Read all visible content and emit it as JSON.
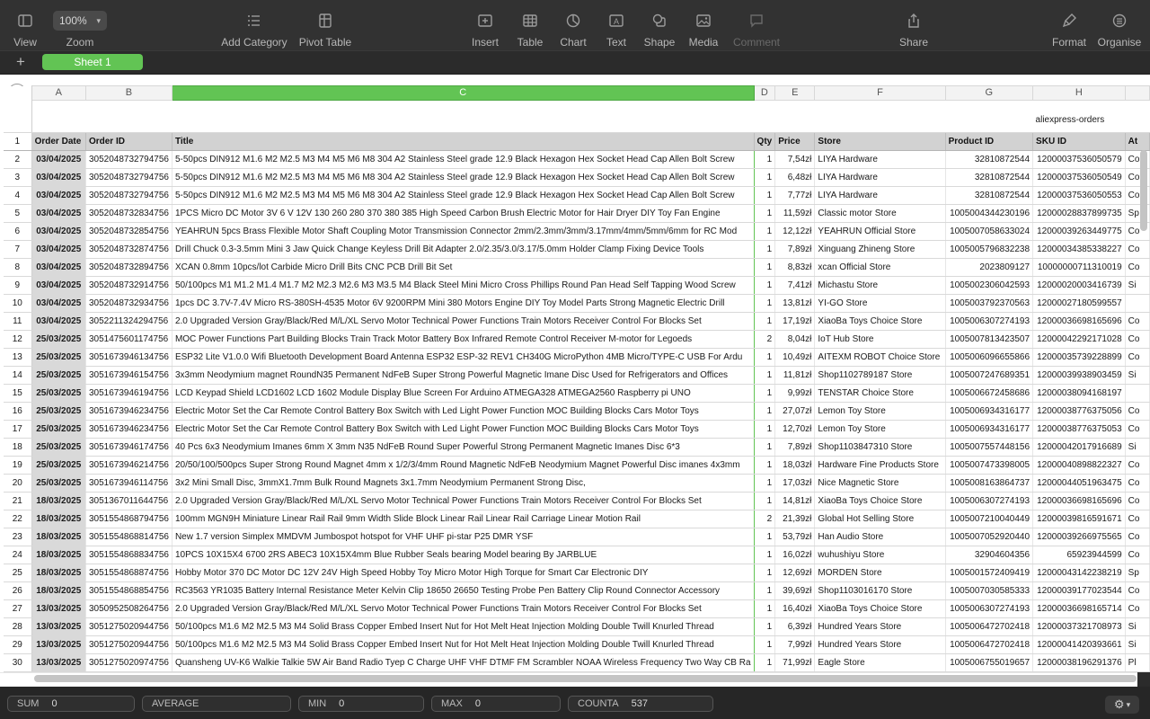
{
  "toolbar": {
    "view": "View",
    "zoom_value": "100%",
    "zoom": "Zoom",
    "add_category": "Add Category",
    "pivot_table": "Pivot Table",
    "insert": "Insert",
    "table": "Table",
    "chart": "Chart",
    "text": "Text",
    "shape": "Shape",
    "media": "Media",
    "comment": "Comment",
    "share": "Share",
    "format": "Format",
    "organise": "Organise"
  },
  "sheets": {
    "active": "Sheet 1",
    "add": "+"
  },
  "columns": [
    "A",
    "B",
    "C",
    "D",
    "E",
    "F",
    "G",
    "H"
  ],
  "selected_column": "C",
  "sheet_title": "aliexpress-orders",
  "headers": [
    "Order Date",
    "Order ID",
    "Title",
    "Qty",
    "Price",
    "Store",
    "Product ID",
    "SKU ID",
    "At"
  ],
  "rows": [
    {
      "n": "2",
      "date": "03/04/2025",
      "id": "3052048732794756",
      "title": "5-50pcs DIN912 M1.6 M2 M2.5 M3 M4 M5 M6 M8 304  A2 Stainless Steel grade 12.9 Black Hexagon Hex Socket Head Cap Allen Bolt Screw",
      "qty": "1",
      "price": "7,54zł",
      "store": "LIYA Hardware",
      "pid": "32810872544",
      "sku": "12000037536050579",
      "a": "Co"
    },
    {
      "n": "3",
      "date": "03/04/2025",
      "id": "3052048732794756",
      "title": "5-50pcs DIN912 M1.6 M2 M2.5 M3 M4 M5 M6 M8 304  A2 Stainless Steel grade 12.9 Black Hexagon Hex Socket Head Cap Allen Bolt Screw",
      "qty": "1",
      "price": "6,48zł",
      "store": "LIYA Hardware",
      "pid": "32810872544",
      "sku": "12000037536050549",
      "a": "Co"
    },
    {
      "n": "4",
      "date": "03/04/2025",
      "id": "3052048732794756",
      "title": "5-50pcs DIN912 M1.6 M2 M2.5 M3 M4 M5 M6 M8 304  A2 Stainless Steel grade 12.9 Black Hexagon Hex Socket Head Cap Allen Bolt Screw",
      "qty": "1",
      "price": "7,77zł",
      "store": "LIYA Hardware",
      "pid": "32810872544",
      "sku": "12000037536050553",
      "a": "Co"
    },
    {
      "n": "5",
      "date": "03/04/2025",
      "id": "3052048732834756",
      "title": "1PCS Micro DC Motor 3V 6 V 12V 130 260 280 370 380 385 High Speed Carbon Brush Electric Motor for Hair Dryer DIY Toy Fan Engine",
      "qty": "1",
      "price": "11,59zł",
      "store": "Classic motor Store",
      "pid": "1005004344230196",
      "sku": "12000028837899735",
      "a": "Sp"
    },
    {
      "n": "6",
      "date": "03/04/2025",
      "id": "3052048732854756",
      "title": "YEAHRUN 5pcs Brass Flexible Motor Shaft Coupling Motor Transmission Connector 2mm/2.3mm/3mm/3.17mm/4mm/5mm/6mm for RC Mod",
      "qty": "1",
      "price": "12,12zł",
      "store": "YEAHRUN Official Store",
      "pid": "1005007058633024",
      "sku": "12000039263449775",
      "a": "Co"
    },
    {
      "n": "7",
      "date": "03/04/2025",
      "id": "3052048732874756",
      "title": "Drill Chuck 0.3-3.5mm Mini 3 Jaw Quick Change Keyless Drill Bit Adapter 2.0/2.35/3.0/3.17/5.0mm Holder Clamp Fixing Device Tools",
      "qty": "1",
      "price": "7,89zł",
      "store": "Xinguang Zhineng Store",
      "pid": "1005005796832238",
      "sku": "12000034385338227",
      "a": "Co"
    },
    {
      "n": "8",
      "date": "03/04/2025",
      "id": "3052048732894756",
      "title": "XCAN 0.8mm 10pcs/lot Carbide Micro Drill Bits CNC PCB Drill Bit Set",
      "qty": "1",
      "price": "8,83zł",
      "store": "xcan Official Store",
      "pid": "2023809127",
      "sku": "10000000711310019",
      "a": "Co"
    },
    {
      "n": "9",
      "date": "03/04/2025",
      "id": "3052048732914756",
      "title": "50/100pcs M1 M1.2 M1.4 M1.7 M2 M2.3 M2.6 M3 M3.5 M4 Black Steel Mini Micro Cross Phillips Round Pan Head Self Tapping Wood Screw",
      "qty": "1",
      "price": "7,41zł",
      "store": "Michastu Store",
      "pid": "1005002306042593",
      "sku": "12000020003416739",
      "a": "Si"
    },
    {
      "n": "10",
      "date": "03/04/2025",
      "id": "3052048732934756",
      "title": "1pcs DC 3.7V-7.4V Micro RS-380SH-4535 Motor 6V 9200RPM Mini 380 Motors Engine DIY Toy Model Parts Strong Magnetic Electric Drill",
      "qty": "1",
      "price": "13,81zł",
      "store": "YI-GO Store",
      "pid": "1005003792370563",
      "sku": "12000027180599557",
      "a": ""
    },
    {
      "n": "11",
      "date": "03/04/2025",
      "id": "3052211324294756",
      "title": "2.0 Upgraded Version Gray/Black/Red M/L/XL Servo Motor Technical Power Functions Train Motors Receiver Control For Blocks Set",
      "qty": "1",
      "price": "17,19zł",
      "store": "XiaoBa Toys Choice Store",
      "pid": "1005006307274193",
      "sku": "12000036698165696",
      "a": "Co"
    },
    {
      "n": "12",
      "date": "25/03/2025",
      "id": "3051475601174756",
      "title": "MOC Power Functions Part Building Blocks Train Track Motor Battery Box Infrared Remote Control Receiver M-motor for Legoeds",
      "qty": "2",
      "price": "8,04zł",
      "store": "IoT Hub Store",
      "pid": "1005007813423507",
      "sku": "12000042292171028",
      "a": "Co"
    },
    {
      "n": "13",
      "date": "25/03/2025",
      "id": "3051673946134756",
      "title": "ESP32 Lite V1.0.0 Wifi Bluetooth Development Board Antenna ESP32 ESP-32 REV1 CH340G MicroPython 4MB Micro/TYPE-C USB For Ardu",
      "qty": "1",
      "price": "10,49zł",
      "store": "AITEXM ROBOT Choice Store",
      "pid": "1005006096655866",
      "sku": "12000035739228899",
      "a": "Co"
    },
    {
      "n": "14",
      "date": "25/03/2025",
      "id": "3051673946154756",
      "title": "3x3mm Neodymium magnet RoundN35 Permanent NdFeB Super Strong Powerful Magnetic Imane Disc Used for Refrigerators and Offices",
      "qty": "1",
      "price": "11,81zł",
      "store": "Shop1102789187 Store",
      "pid": "1005007247689351",
      "sku": "12000039938903459",
      "a": "Si"
    },
    {
      "n": "15",
      "date": "25/03/2025",
      "id": "3051673946194756",
      "title": "LCD Keypad Shield LCD1602 LCD 1602 Module Display Blue Screen For Arduino ATMEGA328 ATMEGA2560 Raspberry pi UNO",
      "qty": "1",
      "price": "9,99zł",
      "store": "TENSTAR Choice Store",
      "pid": "1005006672458686",
      "sku": "12000038094168197",
      "a": ""
    },
    {
      "n": "16",
      "date": "25/03/2025",
      "id": "3051673946234756",
      "title": "Electric Motor Set the Car Remote Control Battery Box Switch with Led Light Power Function MOC Building Blocks Cars Motor Toys",
      "qty": "1",
      "price": "27,07zł",
      "store": "Lemon Toy Store",
      "pid": "1005006934316177",
      "sku": "12000038776375056",
      "a": "Co"
    },
    {
      "n": "17",
      "date": "25/03/2025",
      "id": "3051673946234756",
      "title": "Electric Motor Set the Car Remote Control Battery Box Switch with Led Light Power Function MOC Building Blocks Cars Motor Toys",
      "qty": "1",
      "price": "12,70zł",
      "store": "Lemon Toy Store",
      "pid": "1005006934316177",
      "sku": "12000038776375053",
      "a": "Co"
    },
    {
      "n": "18",
      "date": "25/03/2025",
      "id": "3051673946174756",
      "title": "40 Pcs 6x3 Neodymium Imanes 6mm X 3mm N35 NdFeB Round Super Powerful Strong Permanent Magnetic Imanes Disc 6*3",
      "qty": "1",
      "price": "7,89zł",
      "store": "Shop1103847310 Store",
      "pid": "1005007557448156",
      "sku": "12000042017916689",
      "a": "Si"
    },
    {
      "n": "19",
      "date": "25/03/2025",
      "id": "3051673946214756",
      "title": "20/50/100/500pcs Super Strong Round Magnet 4mm x 1/2/3/4mm Round Magnetic NdFeB Neodymium Magnet Powerful Disc imanes 4x3mm",
      "qty": "1",
      "price": "18,03zł",
      "store": "Hardware Fine Products Store",
      "pid": "1005007473398005",
      "sku": "12000040898822327",
      "a": "Co"
    },
    {
      "n": "20",
      "date": "25/03/2025",
      "id": "3051673946114756",
      "title": "3x2 Mini Small Disc, 3mmX1.7mm Bulk Round Magnets 3x1.7mm Neodymium Permanent Strong Disc,",
      "qty": "1",
      "price": "17,03zł",
      "store": "Nice Magnetic Store",
      "pid": "1005008163864737",
      "sku": "12000044051963475",
      "a": "Co"
    },
    {
      "n": "21",
      "date": "18/03/2025",
      "id": "3051367011644756",
      "title": "2.0 Upgraded Version Gray/Black/Red M/L/XL Servo Motor Technical Power Functions Train Motors Receiver Control For Blocks Set",
      "qty": "1",
      "price": "14,81zł",
      "store": "XiaoBa Toys Choice Store",
      "pid": "1005006307274193",
      "sku": "12000036698165696",
      "a": "Co"
    },
    {
      "n": "22",
      "date": "18/03/2025",
      "id": "3051554868794756",
      "title": "100mm MGN9H Miniature Linear Rail  Rail 9mm Width Slide Block Linear  Rail Linear Rail Carriage Linear Motion Rail",
      "qty": "2",
      "price": "21,39zł",
      "store": "Global Hot Selling Store",
      "pid": "1005007210040449",
      "sku": "12000039816591671",
      "a": "Co"
    },
    {
      "n": "23",
      "date": "18/03/2025",
      "id": "3051554868814756",
      "title": "New 1.7 version Simplex MMDVM Jumbospot hotspot  for  VHF UHF pi-star  P25 DMR YSF",
      "qty": "1",
      "price": "53,79zł",
      "store": "Han Audio Store",
      "pid": "1005007052920440",
      "sku": "12000039266975565",
      "a": "Co"
    },
    {
      "n": "24",
      "date": "18/03/2025",
      "id": "3051554868834756",
      "title": "10PCS 10X15X4 6700 2RS ABEC3 10X15X4mm Blue Rubber Seals bearing Model bearing  By JARBLUE",
      "qty": "1",
      "price": "16,02zł",
      "store": "wuhushiyu Store",
      "pid": "32904604356",
      "sku": "65923944599",
      "a": "Co"
    },
    {
      "n": "25",
      "date": "18/03/2025",
      "id": "3051554868874756",
      "title": "Hobby Motor 370 DC Motor DC 12V 24V High Speed Hobby Toy Micro Motor High Torque for Smart Car Electronic DIY",
      "qty": "1",
      "price": "12,69zł",
      "store": "MORDEN Store",
      "pid": "1005001572409419",
      "sku": "12000043142238219",
      "a": "Sp"
    },
    {
      "n": "26",
      "date": "18/03/2025",
      "id": "3051554868854756",
      "title": "RC3563 YR1035 Battery Internal Resistance Meter Kelvin Clip 18650 26650 Testing Probe Pen Battery Clip Round Connector Accessory",
      "qty": "1",
      "price": "39,69zł",
      "store": "Shop1103016170 Store",
      "pid": "1005007030585333",
      "sku": "12000039177023544",
      "a": "Co"
    },
    {
      "n": "27",
      "date": "13/03/2025",
      "id": "3050952508264756",
      "title": "2.0 Upgraded Version Gray/Black/Red M/L/XL Servo Motor Technical Power Functions Train Motors Receiver Control For Blocks Set",
      "qty": "1",
      "price": "16,40zł",
      "store": "XiaoBa Toys Choice Store",
      "pid": "1005006307274193",
      "sku": "12000036698165714",
      "a": "Co"
    },
    {
      "n": "28",
      "date": "13/03/2025",
      "id": "3051275020944756",
      "title": "50/100pcs M1.6 M2 M2.5 M3 M4 Solid Brass Copper Embed Insert Nut for Hot Melt Heat Injection Molding Double Twill Knurled Thread",
      "qty": "1",
      "price": "6,39zł",
      "store": "Hundred Years Store",
      "pid": "1005006472702418",
      "sku": "12000037321708973",
      "a": "Si"
    },
    {
      "n": "29",
      "date": "13/03/2025",
      "id": "3051275020944756",
      "title": "50/100pcs M1.6 M2 M2.5 M3 M4 Solid Brass Copper Embed Insert Nut for Hot Melt Heat Injection Molding Double Twill Knurled Thread",
      "qty": "1",
      "price": "7,99zł",
      "store": "Hundred Years Store",
      "pid": "1005006472702418",
      "sku": "12000041420393661",
      "a": "Si"
    },
    {
      "n": "30",
      "date": "13/03/2025",
      "id": "3051275020974756",
      "title": "Quansheng UV-K6 Walkie Talkie 5W Air Band Radio Tyep C Charge UHF VHF DTMF FM Scrambler NOAA Wireless Frequency Two Way CB Ra",
      "qty": "1",
      "price": "71,99zł",
      "store": "Eagle Store",
      "pid": "1005006755019657",
      "sku": "12000038196291376",
      "a": "Pl"
    }
  ],
  "status": {
    "sum_label": "SUM",
    "sum": "0",
    "avg_label": "AVERAGE",
    "avg": "",
    "min_label": "MIN",
    "min": "0",
    "max_label": "MAX",
    "max": "0",
    "counta_label": "COUNTA",
    "counta": "537"
  },
  "colors": {
    "accent": "#62c454",
    "toolbar": "#323232"
  }
}
